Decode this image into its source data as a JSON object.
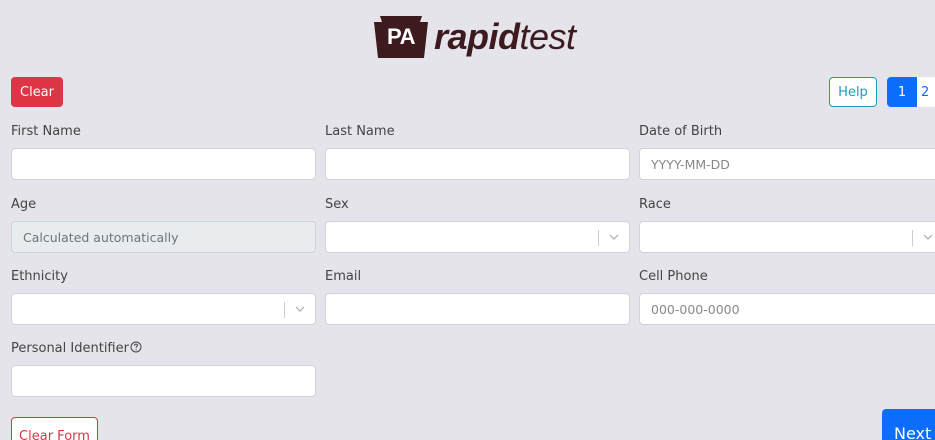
{
  "logo": {
    "badge": "PA",
    "rapid": "rapid",
    "test": "test"
  },
  "toolbar": {
    "clear_label": "Clear",
    "help_label": "Help"
  },
  "pager": {
    "pages": [
      "1",
      "2"
    ],
    "active": "1"
  },
  "form": {
    "first_name": {
      "label": "First Name",
      "value": "",
      "placeholder": ""
    },
    "last_name": {
      "label": "Last Name",
      "value": "",
      "placeholder": ""
    },
    "dob": {
      "label": "Date of Birth",
      "value": "",
      "placeholder": "YYYY-MM-DD"
    },
    "age": {
      "label": "Age",
      "value": "Calculated automatically"
    },
    "sex": {
      "label": "Sex",
      "value": ""
    },
    "race": {
      "label": "Race",
      "value": ""
    },
    "ethnicity": {
      "label": "Ethnicity",
      "value": ""
    },
    "email": {
      "label": "Email",
      "value": "",
      "placeholder": ""
    },
    "cell_phone": {
      "label": "Cell Phone",
      "value": "",
      "placeholder": "000-000-0000"
    },
    "personal_identifier": {
      "label": "Personal Identifier",
      "value": "",
      "placeholder": ""
    }
  },
  "footer": {
    "clear_form_label": "Clear Form",
    "next_label": "Next"
  },
  "colors": {
    "background": "#e4e4ea",
    "danger": "#dc3545",
    "primary": "#0d6efd",
    "info": "#17a2b8",
    "brand": "#3d1a1e"
  }
}
